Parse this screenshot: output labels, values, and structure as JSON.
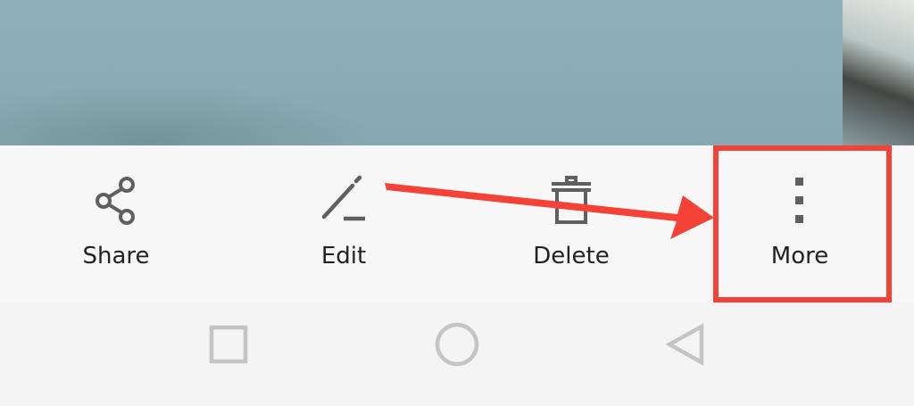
{
  "actions": {
    "share": {
      "label": "Share",
      "icon": "share-icon"
    },
    "edit": {
      "label": "Edit",
      "icon": "edit-pencil-icon"
    },
    "delete": {
      "label": "Delete",
      "icon": "trash-icon"
    },
    "more": {
      "label": "More",
      "icon": "more-vertical-icon"
    }
  },
  "navigation": {
    "recents": {
      "icon": "square-recents-icon"
    },
    "home": {
      "icon": "circle-home-icon"
    },
    "back": {
      "icon": "triangle-back-icon"
    }
  },
  "colors": {
    "icon": "#5f5f5f",
    "label": "#222222",
    "nav_icon": "#c4c4c4",
    "annotation": "#f44336",
    "photo": "#8aacb6"
  }
}
